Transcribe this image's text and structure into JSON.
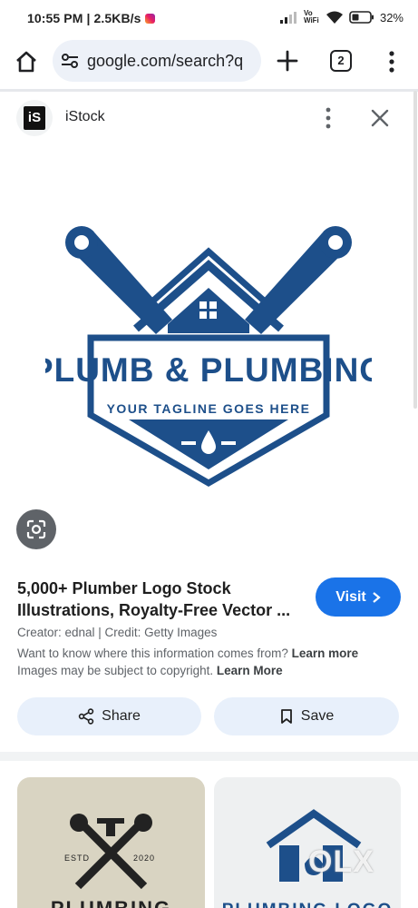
{
  "status_bar": {
    "time": "10:55 PM | 2.5KB/s",
    "volte": "Vo WiFi",
    "battery": "32%"
  },
  "browser": {
    "url": "google.com/search?q",
    "tab_count": "2"
  },
  "source": {
    "logo_text": "iS",
    "name": "iStock"
  },
  "image": {
    "logo_title": "PLUMB & PLUMBING",
    "tagline": "YOUR TAGLINE GOES HERE",
    "brand_color": "#1d4f8a"
  },
  "result": {
    "title_line1": "5,000+ Plumber Logo Stock",
    "title_line2": "Illustrations, Royalty-Free Vector ...",
    "visit_label": "Visit",
    "credit": "Creator: ednal | Credit: Getty Images",
    "info_text": "Want to know where this information comes from?",
    "info_link": "Learn more",
    "copyright_text": "Images may be subject to copyright.",
    "copyright_link": "Learn More"
  },
  "actions": {
    "share_label": "Share",
    "save_label": "Save"
  },
  "related": [
    {
      "caption": "PLUMBING",
      "estd": "ESTD",
      "year": "2020"
    },
    {
      "caption": "PLUMBING LOGO"
    }
  ],
  "watermark": "OLX"
}
